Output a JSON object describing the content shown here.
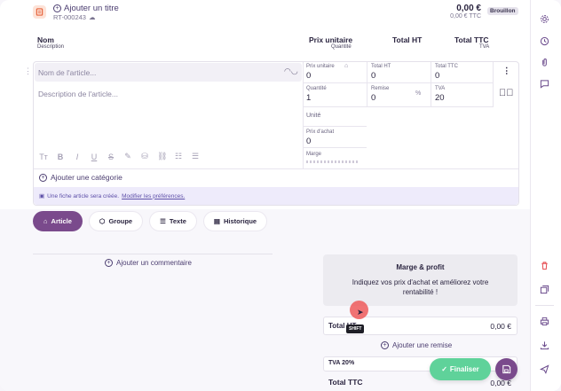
{
  "header": {
    "add_title": "Ajouter un titre",
    "reference": "RT-000243",
    "total": "0,00 €",
    "total_ttc": "0,00 € TTC",
    "status_badge": "Brouillon"
  },
  "columns": {
    "name": "Nom",
    "description": "Description",
    "unit_price": "Prix unitaire",
    "quantity": "Quantité",
    "total_ht": "Total HT",
    "total_ttc": "Total TTC",
    "tva": "TVA"
  },
  "line": {
    "name_placeholder": "Nom de l'article...",
    "description_placeholder": "Description de l'article...",
    "unit_price_label": "Prix unitaire",
    "unit_price_value": "0",
    "total_ht_label": "Total HT",
    "total_ht_value": "0",
    "total_ttc_label": "Total TTC",
    "total_ttc_value": "0",
    "quantity_label": "Quantité",
    "quantity_value": "1",
    "discount_label": "Remise",
    "discount_value": "0",
    "discount_unit": "%",
    "tva_label": "TVA",
    "tva_value": "20",
    "unit_label": "Unité",
    "purchase_price_label": "Prix d'achat",
    "purchase_price_value": "0",
    "margin_label": "Marge",
    "add_category": "Ajouter une catégorie",
    "info_text": "Une fiche article sera créée.",
    "info_link": "Modifier les préférences."
  },
  "toolbar": [
    "Tт",
    "B",
    "I",
    "U",
    "S",
    "✎",
    "⛁",
    "⛓",
    "☷",
    "☰"
  ],
  "tabs": {
    "article": "Article",
    "group": "Groupe",
    "text": "Texte",
    "history": "Historique"
  },
  "add_comment": "Ajouter un commentaire",
  "margin_panel": {
    "title": "Marge & profit",
    "text": "Indiquez vos prix d'achat et améliorez votre rentabilité !"
  },
  "totals": {
    "total_ht_label": "Total HT",
    "total_ht_value": "0,00 €",
    "add_discount": "Ajouter une remise",
    "tva_label": "TVA 20%",
    "total_ttc_label": "Total TTC",
    "total_ttc_value": "0,00 €"
  },
  "shift_tooltip": "SHIFT",
  "finalize_label": "Finaliser",
  "sidebar_icons": [
    "settings-icon",
    "history-icon",
    "attachment-icon",
    "comment-icon",
    "delete-icon",
    "duplicate-icon",
    "print-icon",
    "download-icon",
    "send-icon"
  ],
  "colors": {
    "primary": "#7a4a8c",
    "success": "#5fd29a",
    "danger": "#e5484d",
    "info_bg": "#eeebfb"
  }
}
